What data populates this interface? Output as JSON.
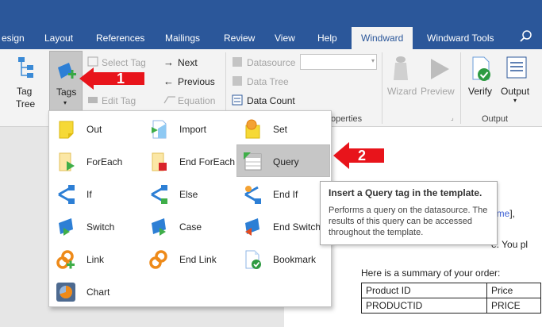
{
  "tabs": {
    "design": "esign",
    "layout": "Layout",
    "references": "References",
    "mailings": "Mailings",
    "review": "Review",
    "view": "View",
    "help": "Help",
    "windward": "Windward",
    "windward_tools": "Windward Tools"
  },
  "ribbon": {
    "tag_tree": [
      "Tag",
      "Tree"
    ],
    "tags": "Tags",
    "select_tag": "Select Tag",
    "edit_tag": "Edit Tag",
    "next": "Next",
    "previous": "Previous",
    "equation": "Equation",
    "datasource": "Datasource",
    "data_tree": "Data Tree",
    "data_count": "Data Count",
    "wizard": "Wizard",
    "preview": "Preview",
    "verify": "Verify",
    "output": "Output",
    "properties_group": "operties",
    "output_group": "Output"
  },
  "menu": {
    "items": [
      {
        "label": "Out",
        "icon": "out-tag-icon"
      },
      {
        "label": "Import",
        "icon": "import-tag-icon"
      },
      {
        "label": "Set",
        "icon": "set-tag-icon"
      },
      {
        "label": "ForEach",
        "icon": "foreach-tag-icon"
      },
      {
        "label": "End ForEach",
        "icon": "end-foreach-tag-icon"
      },
      {
        "label": "Query",
        "icon": "query-tag-icon"
      },
      {
        "label": "If",
        "icon": "if-tag-icon"
      },
      {
        "label": "Else",
        "icon": "else-tag-icon"
      },
      {
        "label": "End If",
        "icon": "end-if-tag-icon"
      },
      {
        "label": "Switch",
        "icon": "switch-tag-icon"
      },
      {
        "label": "Case",
        "icon": "case-tag-icon"
      },
      {
        "label": "End Switch",
        "icon": "end-switch-tag-icon"
      },
      {
        "label": "Link",
        "icon": "link-tag-icon"
      },
      {
        "label": "End Link",
        "icon": "end-link-tag-icon"
      },
      {
        "label": "Bookmark",
        "icon": "bookmark-tag-icon"
      },
      {
        "label": "Chart",
        "icon": "chart-tag-icon"
      }
    ]
  },
  "tooltip": {
    "title": "Insert a Query tag in the template.",
    "body": "Performs a query on the datasource. The results of this query can be accessed throughout the template."
  },
  "annotations": {
    "badge1": "1",
    "badge2": "2"
  },
  "document": {
    "line_name_fragment": "ame",
    "line_name_suffix": "],",
    "line_e": "e. You pl",
    "summary": "Here is a summary of your order:",
    "table": [
      [
        "Product ID",
        "Price"
      ],
      [
        "PRODUCTID",
        "PRICE"
      ]
    ]
  },
  "colors": {
    "accent": "#2b579a",
    "arrow_red": "#e8141b",
    "tag_link": "#3b5fd4"
  }
}
